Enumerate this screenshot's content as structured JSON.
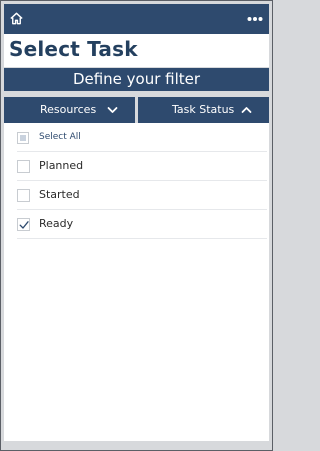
{
  "topbar": {
    "home_icon": "home-icon",
    "more_icon": "more-horizontal-icon"
  },
  "page": {
    "title": "Select Task"
  },
  "filter": {
    "banner": "Define your filter"
  },
  "tabs": [
    {
      "label": "Resources",
      "icon": "chevron-down-icon",
      "expanded": false
    },
    {
      "label": "Task Status",
      "icon": "chevron-up-icon",
      "expanded": true
    }
  ],
  "status_options": {
    "select_all": {
      "label": "Select All",
      "state": "indeterminate"
    },
    "items": [
      {
        "label": "Planned",
        "checked": false
      },
      {
        "label": "Started",
        "checked": false
      },
      {
        "label": "Ready",
        "checked": true
      }
    ]
  },
  "colors": {
    "header_bg": "#2e4a6e",
    "page_bg": "#d7d9dc",
    "panel_bg": "#ffffff",
    "title_text": "#24405f"
  }
}
